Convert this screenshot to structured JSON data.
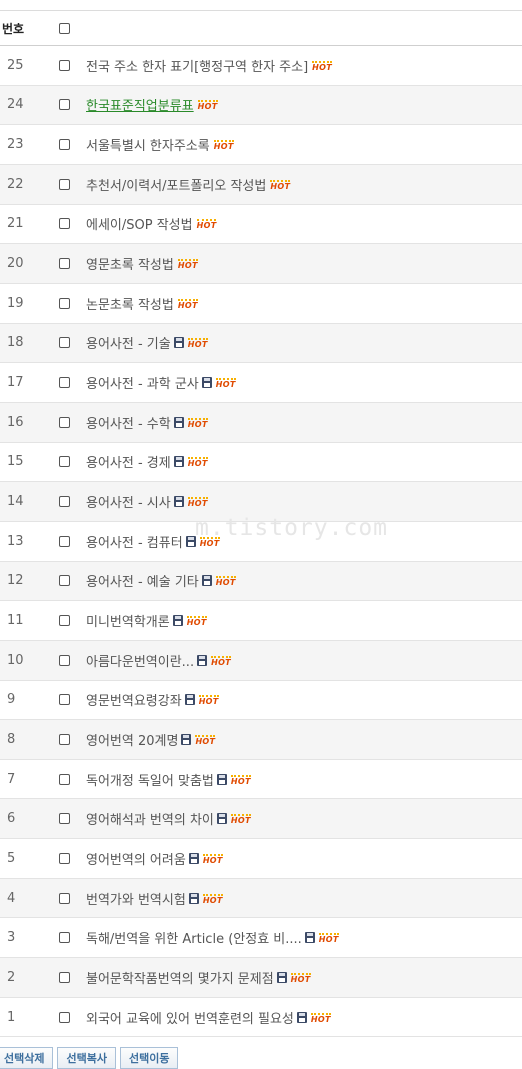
{
  "header": {
    "number_label": "번호"
  },
  "watermark": "m.tistory.com",
  "posts": [
    {
      "number": "25",
      "title": "전국 주소 한자 표기[행정구역 한자 주소]",
      "hot": "HOT",
      "disk": false,
      "link": false
    },
    {
      "number": "24",
      "title": "한국표준직업분류표",
      "hot": "HOT",
      "disk": false,
      "link": true
    },
    {
      "number": "23",
      "title": "서울특별시 한자주소록",
      "hot": "HOT",
      "disk": false,
      "link": false
    },
    {
      "number": "22",
      "title": "추천서/이력서/포트폴리오 작성법",
      "hot": "HOT",
      "disk": false,
      "link": false
    },
    {
      "number": "21",
      "title": "에세이/SOP 작성법",
      "hot": "HOT",
      "disk": false,
      "link": false
    },
    {
      "number": "20",
      "title": "영문초록 작성법",
      "hot": "HOT",
      "disk": false,
      "link": false
    },
    {
      "number": "19",
      "title": "논문초록 작성법",
      "hot": "HOT",
      "disk": false,
      "link": false
    },
    {
      "number": "18",
      "title": "용어사전 - 기술",
      "hot": "HOT",
      "disk": true,
      "link": false
    },
    {
      "number": "17",
      "title": "용어사전 - 과학 군사",
      "hot": "HOT",
      "disk": true,
      "link": false
    },
    {
      "number": "16",
      "title": "용어사전 - 수학",
      "hot": "HOT",
      "disk": true,
      "link": false
    },
    {
      "number": "15",
      "title": "용어사전 - 경제",
      "hot": "HOT",
      "disk": true,
      "link": false
    },
    {
      "number": "14",
      "title": "용어사전 - 시사",
      "hot": "HOT",
      "disk": true,
      "link": false
    },
    {
      "number": "13",
      "title": "용어사전 - 컴퓨터",
      "hot": "HOT",
      "disk": true,
      "link": false
    },
    {
      "number": "12",
      "title": "용어사전 - 예술 기타",
      "hot": "HOT",
      "disk": true,
      "link": false
    },
    {
      "number": "11",
      "title": "미니번역학개론",
      "hot": "HOT",
      "disk": true,
      "link": false
    },
    {
      "number": "10",
      "title": "아름다운번역이란...",
      "hot": "HOT",
      "disk": true,
      "link": false
    },
    {
      "number": "9",
      "title": "영문번역요령강좌",
      "hot": "HOT",
      "disk": true,
      "link": false
    },
    {
      "number": "8",
      "title": "영어번역 20계명",
      "hot": "HOT",
      "disk": true,
      "link": false
    },
    {
      "number": "7",
      "title": "독어개정 독일어 맞춤법",
      "hot": "HOT",
      "disk": true,
      "link": false
    },
    {
      "number": "6",
      "title": "영어해석과 번역의 차이",
      "hot": "HOT",
      "disk": true,
      "link": false
    },
    {
      "number": "5",
      "title": "영어번역의 어려움",
      "hot": "HOT",
      "disk": true,
      "link": false
    },
    {
      "number": "4",
      "title": "번역가와 번역시험",
      "hot": "HOT",
      "disk": true,
      "link": false
    },
    {
      "number": "3",
      "title": "독해/번역을 위한 Article (안정효 비....",
      "hot": "HOT",
      "disk": true,
      "link": false
    },
    {
      "number": "2",
      "title": "불어문학작품번역의 몇가지 문제점",
      "hot": "HOT",
      "disk": true,
      "link": false
    },
    {
      "number": "1",
      "title": "외국어 교육에 있어 번역훈련의 필요성",
      "hot": "HOT",
      "disk": true,
      "link": false
    }
  ],
  "actions": {
    "delete_label": "선택삭제",
    "copy_label": "선택복사",
    "move_label": "선택이동"
  }
}
